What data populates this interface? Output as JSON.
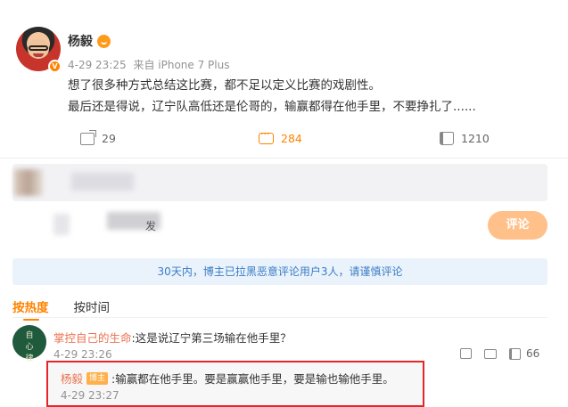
{
  "post": {
    "author": "杨毅",
    "timestamp": "4-29 23:25",
    "source": "来自 iPhone 7 Plus",
    "content_line1": "想了很多种方式总结这比赛，都不足以定义比赛的戏剧性。",
    "content_line2": "最后还是得说，辽宁队高低还是伦哥的，输赢都得在他手里，不要挣扎了......",
    "verified_badge": "V",
    "avatar_icon": "user-avatar",
    "crown_icon": "crown-icon"
  },
  "actions": {
    "share_count": "29",
    "comment_count": "284",
    "like_count": "1210"
  },
  "composer": {
    "blurred_text": "发",
    "submit_label": "评论"
  },
  "notice": {
    "text": "30天内，博主已拉黑恶意评论用户3人，请谨慎评论"
  },
  "tabs": [
    {
      "label": "按热度",
      "active": true
    },
    {
      "label": "按时间",
      "active": false
    }
  ],
  "comment": {
    "author": "掌控自己的生命",
    "text": ":这是说辽宁第三场输在他手里？",
    "timestamp": "4-29 23:26",
    "like_count": "66",
    "avatar_text": "自\n心\n律"
  },
  "reply": {
    "author": "杨毅",
    "tag": "博主",
    "text": ":输赢都在他手里。要是赢赢他手里，要是输也输他手里。",
    "timestamp": "4-29 23:27"
  },
  "colors": {
    "accent": "#ff8200",
    "name": "#eb7350",
    "notice_text": "#3a7cc4",
    "highlight_border": "#e3262a"
  }
}
